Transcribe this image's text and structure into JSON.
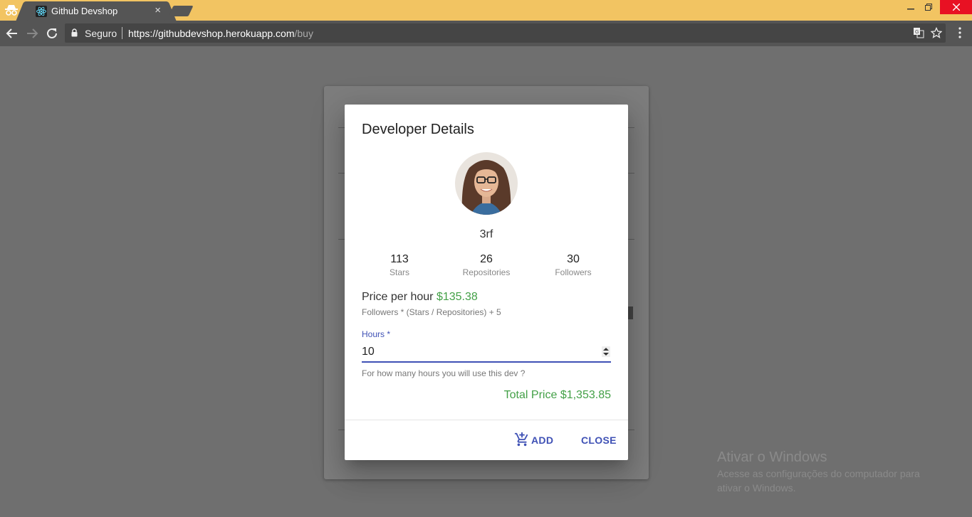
{
  "browser": {
    "tab_title": "Github Devshop",
    "tab_close": "×",
    "security_label": "Seguro",
    "url_base": "https://githubdevshop.herokuapp.com",
    "url_path": "/buy"
  },
  "modal": {
    "title": "Developer Details",
    "dev_name": "3rf",
    "stats": [
      {
        "value": "113",
        "label": "Stars"
      },
      {
        "value": "26",
        "label": "Repositories"
      },
      {
        "value": "30",
        "label": "Followers"
      }
    ],
    "price_label": "Price per hour",
    "price_value": "$135.38",
    "formula": "Followers * (Stars / Repositories) + 5",
    "hours_label": "Hours *",
    "hours_value": "10",
    "hours_helper": "For how many hours you will use this dev ?",
    "total_label": "Total Price",
    "total_value": "$1,353.85",
    "add_label": "ADD",
    "close_label": "CLOSE"
  },
  "watermark": {
    "title": "Ativar o Windows",
    "line1": "Acesse as configurações do computador para",
    "line2": "ativar o Windows."
  },
  "colors": {
    "accent": "#3f51b5",
    "price_green": "#43a047",
    "chrome_tab_bar": "#f2c462"
  }
}
